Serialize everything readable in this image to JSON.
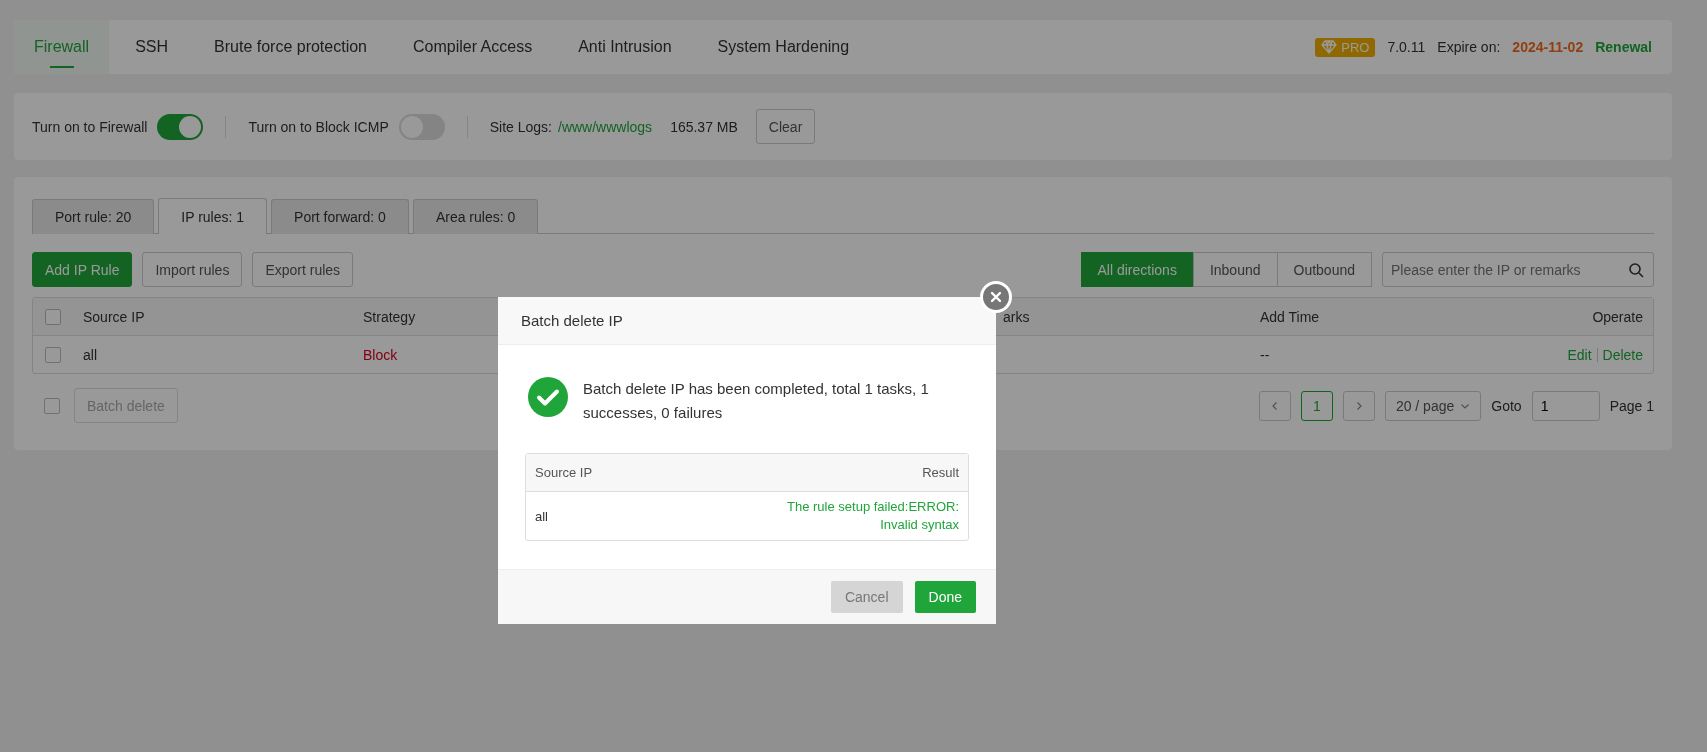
{
  "nav": {
    "tabs": [
      {
        "label": "Firewall",
        "selected": true
      },
      {
        "label": "SSH",
        "selected": false
      },
      {
        "label": "Brute force protection",
        "selected": false
      },
      {
        "label": "Compiler Access",
        "selected": false
      },
      {
        "label": "Anti Intrusion",
        "selected": false
      },
      {
        "label": "System Hardening",
        "selected": false
      }
    ],
    "badge": "PRO",
    "version": "7.0.11",
    "expire_label": "Expire on:",
    "expire_date": "2024-11-02",
    "renewal": "Renewal"
  },
  "settings": {
    "toggles": [
      {
        "label": "Turn on to Firewall",
        "on": true
      },
      {
        "label": "Turn on to Block ICMP",
        "on": false
      }
    ],
    "logs_label": "Site Logs:",
    "logs_path": "/www/wwwlogs",
    "logs_size": "165.37 MB",
    "clear": "Clear"
  },
  "rule_tabs": [
    {
      "label": "Port rule: 20",
      "selected": false
    },
    {
      "label": "IP rules: 1",
      "selected": true
    },
    {
      "label": "Port forward: 0",
      "selected": false
    },
    {
      "label": "Area rules: 0",
      "selected": false
    }
  ],
  "actions": [
    {
      "label": "Add IP Rule",
      "kind": "primary"
    },
    {
      "label": "Import rules",
      "kind": "default"
    },
    {
      "label": "Export rules",
      "kind": "default"
    }
  ],
  "directions": [
    {
      "label": "All directions",
      "selected": true
    },
    {
      "label": "Inbound",
      "selected": false
    },
    {
      "label": "Outbound",
      "selected": false
    }
  ],
  "search": {
    "placeholder": "Please enter the IP or remarks"
  },
  "table": {
    "all_checked": false,
    "columns": [
      "Source IP",
      "Strategy",
      "arks",
      "Add Time",
      "Operate"
    ],
    "rows": [
      {
        "checked": false,
        "source_ip": "all",
        "strategy": "Block",
        "add_time": "--",
        "actions": [
          "Edit",
          "Delete"
        ]
      }
    ]
  },
  "footer": {
    "checked": false,
    "batch_delete": {
      "label": "Batch delete",
      "disabled": true
    },
    "pages": [
      {
        "label": "1",
        "selected": true
      }
    ],
    "per_page": "20 / page",
    "goto_label": "Goto",
    "goto_value": "1",
    "page_label": "Page 1"
  },
  "modal": {
    "title": "Batch delete IP",
    "message": "Batch delete IP has been completed, total 1 tasks, 1 successes, 0 failures",
    "columns": [
      "Source IP",
      "Result"
    ],
    "rows": [
      {
        "source_ip": "all",
        "result": "The rule setup failed:ERROR: Invalid syntax"
      }
    ],
    "buttons": [
      {
        "label": "Cancel",
        "kind": "disabled"
      },
      {
        "label": "Done",
        "kind": "primary"
      }
    ]
  }
}
